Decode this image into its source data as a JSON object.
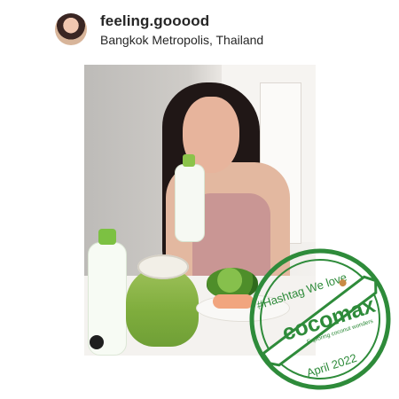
{
  "header": {
    "username": "feeling.gooood",
    "location": "Bangkok Metropolis, Thailand"
  },
  "photo": {
    "product_brand": "cocomax"
  },
  "stamp": {
    "headline": "#Hashtag We love",
    "brand": "cocomax",
    "tagline": "Exploring coconut wonders",
    "date": "April 2022",
    "accent": "#2e8b3a"
  }
}
